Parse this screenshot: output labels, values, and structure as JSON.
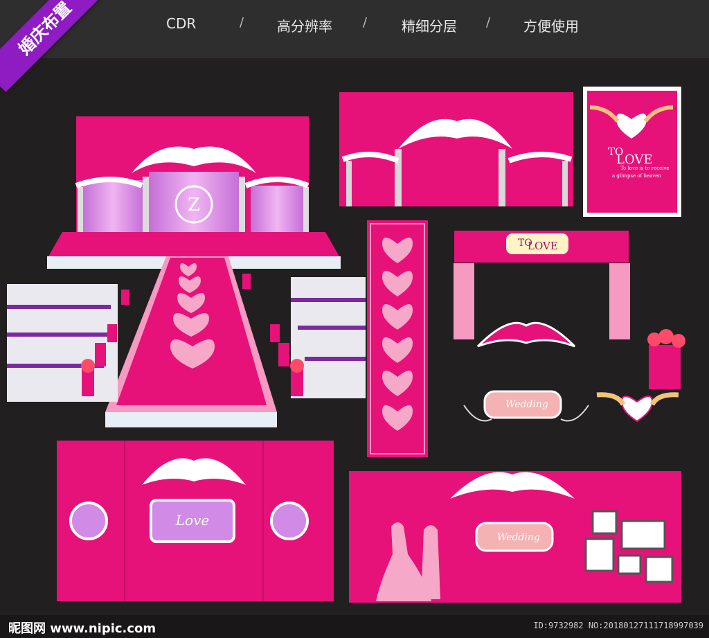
{
  "ribbon": {
    "label": "婚庆布置"
  },
  "tabs": [
    {
      "label": "CDR"
    },
    {
      "label": "高分辨率"
    },
    {
      "label": "精细分层"
    },
    {
      "label": "方便使用"
    }
  ],
  "separator": "/",
  "poster": {
    "title_to": "TO",
    "title_love": "LOVE",
    "line1": "To love is to receive",
    "line2": "a glimpse of heaven"
  },
  "arch_sign": {
    "to": "TO",
    "love": "LOVE"
  },
  "wedding_sign_label": "Wedding",
  "stage_monogram": "Z",
  "backdrop_monogram": "Love",
  "footer": {
    "logo": "昵图网 www.nipic.com",
    "id": "ID:9732982 NO:20180127111718997039"
  },
  "colors": {
    "background": "#221f20",
    "magenta": "#e6127a",
    "pink": "#f59ac0",
    "purple": "#8e1cc2"
  }
}
